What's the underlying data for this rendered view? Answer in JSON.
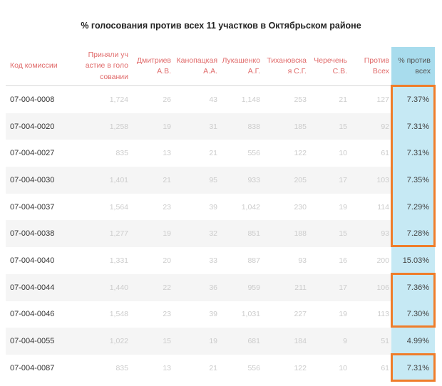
{
  "title": "% голосования против всех 11 участков в Октябрьском районе",
  "columns": [
    {
      "label": "Код комиссии"
    },
    {
      "label": "Приняли уч\nастие в голо\nсовании"
    },
    {
      "label": "Дмитриев\nА.В."
    },
    {
      "label": "Канопацкая\nА.А."
    },
    {
      "label": "Лукашенко\nА.Г."
    },
    {
      "label": "Тихановска\nя С.Г."
    },
    {
      "label": "Черечень\nС.В."
    },
    {
      "label": "Против Всех"
    },
    {
      "label": "% против\nвсех"
    }
  ],
  "rows": [
    {
      "code": "07-004-0008",
      "voted": "1,724",
      "dmitriev": "26",
      "kanopatskaya": "43",
      "lukashenko": "1,148",
      "tikhanovskaya": "253",
      "cherechen": "21",
      "against": "127",
      "pct": "7.37%",
      "highlighted": true
    },
    {
      "code": "07-004-0020",
      "voted": "1,258",
      "dmitriev": "19",
      "kanopatskaya": "31",
      "lukashenko": "838",
      "tikhanovskaya": "185",
      "cherechen": "15",
      "against": "92",
      "pct": "7.31%",
      "highlighted": true
    },
    {
      "code": "07-004-0027",
      "voted": "835",
      "dmitriev": "13",
      "kanopatskaya": "21",
      "lukashenko": "556",
      "tikhanovskaya": "122",
      "cherechen": "10",
      "against": "61",
      "pct": "7.31%",
      "highlighted": true
    },
    {
      "code": "07-004-0030",
      "voted": "1,401",
      "dmitriev": "21",
      "kanopatskaya": "95",
      "lukashenko": "933",
      "tikhanovskaya": "205",
      "cherechen": "17",
      "against": "103",
      "pct": "7.35%",
      "highlighted": true
    },
    {
      "code": "07-004-0037",
      "voted": "1,564",
      "dmitriev": "23",
      "kanopatskaya": "39",
      "lukashenko": "1,042",
      "tikhanovskaya": "230",
      "cherechen": "19",
      "against": "114",
      "pct": "7.29%",
      "highlighted": true
    },
    {
      "code": "07-004-0038",
      "voted": "1,277",
      "dmitriev": "19",
      "kanopatskaya": "32",
      "lukashenko": "851",
      "tikhanovskaya": "188",
      "cherechen": "15",
      "against": "93",
      "pct": "7.28%",
      "highlighted": true
    },
    {
      "code": "07-004-0040",
      "voted": "1,331",
      "dmitriev": "20",
      "kanopatskaya": "33",
      "lukashenko": "887",
      "tikhanovskaya": "93",
      "cherechen": "16",
      "against": "200",
      "pct": "15.03%",
      "highlighted": false
    },
    {
      "code": "07-004-0044",
      "voted": "1,440",
      "dmitriev": "22",
      "kanopatskaya": "36",
      "lukashenko": "959",
      "tikhanovskaya": "211",
      "cherechen": "17",
      "against": "106",
      "pct": "7.36%",
      "highlighted": true
    },
    {
      "code": "07-004-0046",
      "voted": "1,548",
      "dmitriev": "23",
      "kanopatskaya": "39",
      "lukashenko": "1,031",
      "tikhanovskaya": "227",
      "cherechen": "19",
      "against": "113",
      "pct": "7.30%",
      "highlighted": true
    },
    {
      "code": "07-004-0055",
      "voted": "1,022",
      "dmitriev": "15",
      "kanopatskaya": "19",
      "lukashenko": "681",
      "tikhanovskaya": "184",
      "cherechen": "9",
      "against": "51",
      "pct": "4.99%",
      "highlighted": false
    },
    {
      "code": "07-004-0087",
      "voted": "835",
      "dmitriev": "13",
      "kanopatskaya": "21",
      "lukashenko": "556",
      "tikhanovskaya": "122",
      "cherechen": "10",
      "against": "61",
      "pct": "7.31%",
      "highlighted": true
    }
  ],
  "colors": {
    "header_text": "#e06a6a",
    "pct_header_bg": "#a8dced",
    "pct_cell_bg": "#c6e9f4",
    "highlight_border": "#ef7d2a",
    "faded_number": "#cccccc"
  }
}
